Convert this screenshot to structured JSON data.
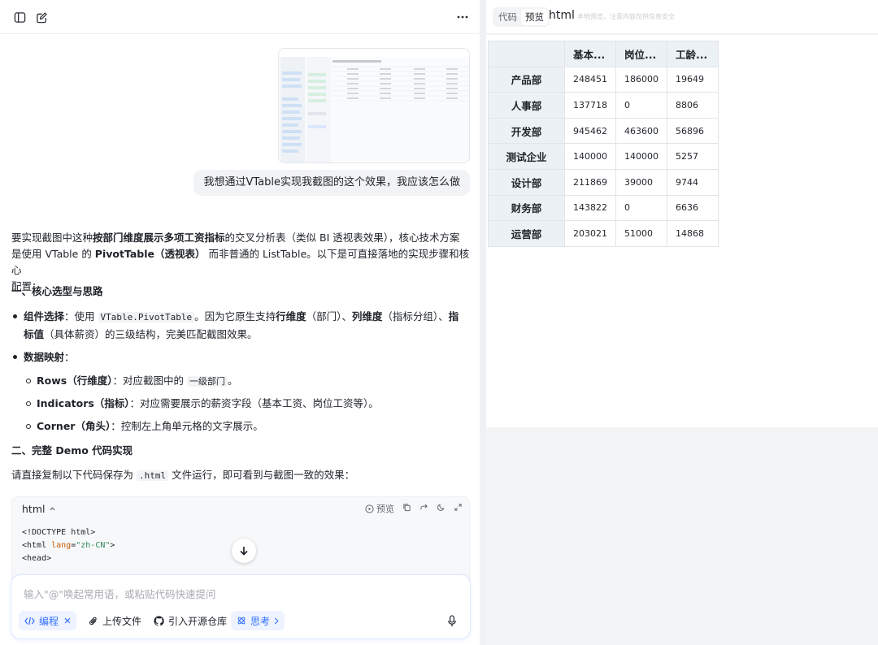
{
  "left": {
    "user_message": "我想通过VTable实现我截图的这个效果，我应该怎么做",
    "answer": {
      "intro": {
        "t1": "要实现截图中这种",
        "b1": "按部门维度展示多项工资指标",
        "t2": "的交叉分析表（类似 BI 透视表效果），核心技术方案",
        "t3": "是使用 VTable 的 ",
        "b2": "PivotTable（透视表）",
        "t4": " 而非普通的 ListTable。以下是可直接落地的实现步骤和核心",
        "t5": "配置："
      },
      "h1": "一、核心选型与思路",
      "bullet1": {
        "label": "组件选择",
        "t1": "：使用 ",
        "code": "VTable.PivotTable",
        "t2": "。因为它原生支持",
        "b1": "行维度",
        "t3": "（部门）、",
        "b2": "列维度",
        "t4": "（指标分组）、",
        "b3": "指",
        "b4": "标值",
        "t5": "（具体薪资）的三级结构，完美匹配截图效果。"
      },
      "bullet2_label": "数据映射",
      "bullet2_colon": "：",
      "sub1": {
        "label": "Rows（行维度）",
        "t1": "：对应截图中的 ",
        "code": "一级部门",
        "t2": "。"
      },
      "sub2": {
        "label": "Indicators（指标）",
        "t1": "：对应需要展示的薪资字段（基本工资、岗位工资等）。"
      },
      "sub3": {
        "label": "Corner（角头）",
        "t1": "：控制左上角单元格的文字展示。"
      },
      "h2": "二、完整 Demo 代码实现",
      "p2": {
        "t1": "请直接复制以下代码保存为 ",
        "code": ".html",
        "t2": " 文件运行，即可看到与截图一致的效果："
      }
    },
    "codeblock": {
      "lang": "html",
      "preview_label": "预览",
      "lines": [
        "<!DOCTYPE html>",
        "<html lang=\"zh-CN\">",
        "<head>"
      ],
      "line2_parts": {
        "a": "<html ",
        "b": "lang",
        "c": "=",
        "d": "\"zh-CN\"",
        "e": ">"
      }
    },
    "input": {
      "placeholder": "输入\"@\"唤起常用语，或粘贴代码快速提问",
      "chips": {
        "code": "编程",
        "upload": "上传文件",
        "repo": "引入开源仓库",
        "think": "思考"
      }
    }
  },
  "right": {
    "tabs": {
      "code": "代码",
      "preview": "预览"
    },
    "title": "html",
    "subtitle": "本地预览，注意内容仅供信息安全",
    "table": {
      "columns": [
        "基本...",
        "岗位...",
        "工龄..."
      ],
      "rows": [
        {
          "dept": "产品部",
          "values": [
            "248451",
            "186000",
            "19649"
          ]
        },
        {
          "dept": "人事部",
          "values": [
            "137718",
            "0",
            "8806"
          ]
        },
        {
          "dept": "开发部",
          "values": [
            "945462",
            "463600",
            "56896"
          ]
        },
        {
          "dept": "测试企业",
          "values": [
            "140000",
            "140000",
            "5257"
          ]
        },
        {
          "dept": "设计部",
          "values": [
            "211869",
            "39000",
            "9744"
          ]
        },
        {
          "dept": "财务部",
          "values": [
            "143822",
            "0",
            "6636"
          ]
        },
        {
          "dept": "运营部",
          "values": [
            "203021",
            "51000",
            "14868"
          ]
        }
      ]
    }
  }
}
